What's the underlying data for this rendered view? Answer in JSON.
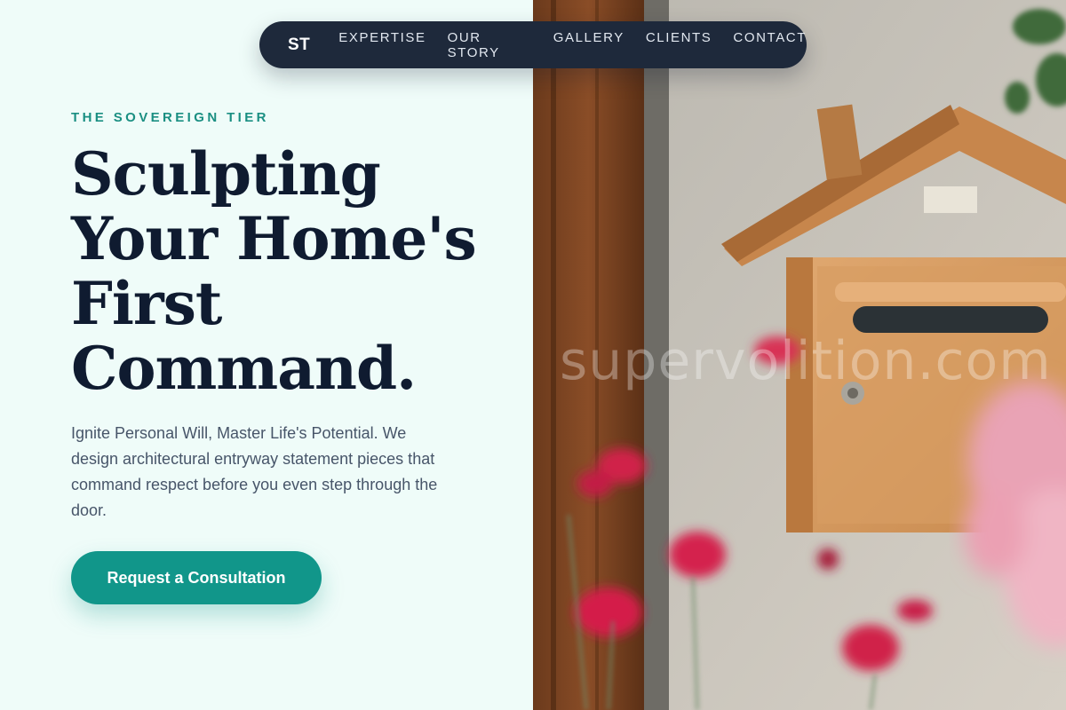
{
  "nav": {
    "logo": "ST",
    "links": [
      "EXPERTISE",
      "OUR STORY",
      "GALLERY",
      "CLIENTS",
      "CONTACT"
    ]
  },
  "hero": {
    "eyebrow": "THE SOVEREIGN TIER",
    "headline_lines": [
      "Sculpting",
      "Your Home's",
      "First",
      "Command."
    ],
    "body": "Ignite Personal Will, Master Life's Potential. We design architectural entryway statement pieces that command respect before you even step through the door.",
    "cta": "Request a Consultation"
  },
  "image": {
    "watermark": "supervolition.com",
    "subject": "wooden-mailbox-photo"
  },
  "colors": {
    "background": "#effcf9",
    "nav_bg": "#1e293b",
    "accent": "#11968a",
    "heading": "#0f1b30",
    "body_text": "#475569"
  }
}
